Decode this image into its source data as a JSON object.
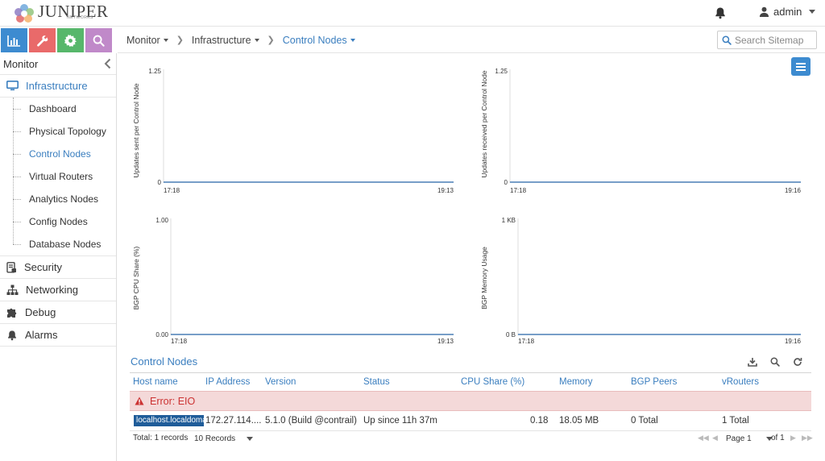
{
  "brand": {
    "name": "JUNIPER",
    "sub": "NETWORKS"
  },
  "user": {
    "name": "admin"
  },
  "search": {
    "placeholder": "Search Sitemap"
  },
  "breadcrumb": [
    {
      "label": "Monitor"
    },
    {
      "label": "Infrastructure"
    },
    {
      "label": "Control Nodes"
    }
  ],
  "sidebar": {
    "header": "Monitor",
    "section": "Infrastructure",
    "sub_items": [
      {
        "label": "Dashboard"
      },
      {
        "label": "Physical Topology"
      },
      {
        "label": "Control Nodes"
      },
      {
        "label": "Virtual Routers"
      },
      {
        "label": "Analytics Nodes"
      },
      {
        "label": "Config Nodes"
      },
      {
        "label": "Database Nodes"
      }
    ],
    "items": [
      {
        "label": "Security"
      },
      {
        "label": "Networking"
      },
      {
        "label": "Debug"
      },
      {
        "label": "Alarms"
      }
    ]
  },
  "charts": [
    {
      "ylabel": "Updates sent per Control Node",
      "ymax": "1.25",
      "ymin": "0",
      "xstart": "17:18",
      "xend": "19:13"
    },
    {
      "ylabel": "Updates received per Control Node",
      "ymax": "1.25",
      "ymin": "0",
      "xstart": "17:18",
      "xend": "19:16"
    },
    {
      "ylabel": "BGP CPU Share (%)",
      "ymax": "1.00",
      "ymin": "0.00",
      "xstart": "17:18",
      "xend": "19:13"
    },
    {
      "ylabel": "BGP Memory Usage",
      "ymax": "1 KB",
      "ymin": "0 B",
      "xstart": "17:18",
      "xend": "19:16"
    }
  ],
  "grid": {
    "title": "Control Nodes",
    "columns": [
      "Host name",
      "IP Address",
      "Version",
      "Status",
      "CPU Share (%)",
      "Memory",
      "BGP Peers",
      "vRouters"
    ],
    "error": "Error: EIO",
    "rows": [
      {
        "host": "localhost.localdomain",
        "ip": "172.27.114....",
        "version": "5.1.0 (Build @contrail)",
        "status": "Up since 11h 37m",
        "cpu": "0.18",
        "memory": "18.05 MB",
        "bgp_peers": "0 Total",
        "vrouters": "1 Total"
      }
    ],
    "footer": {
      "total": "Total: 1 records",
      "page_size": "10 Records",
      "page_label": "Page 1",
      "of_label": "of 1"
    }
  },
  "colors": {
    "accent": "#3a7ebf",
    "monitor": "#3d8bd0",
    "configure": "#e96a6a",
    "settings": "#57b76b",
    "query": "#c089c9",
    "error_bg": "#f4d9d9",
    "error_text": "#cc3333",
    "axis_line": "#4a7fb5"
  }
}
